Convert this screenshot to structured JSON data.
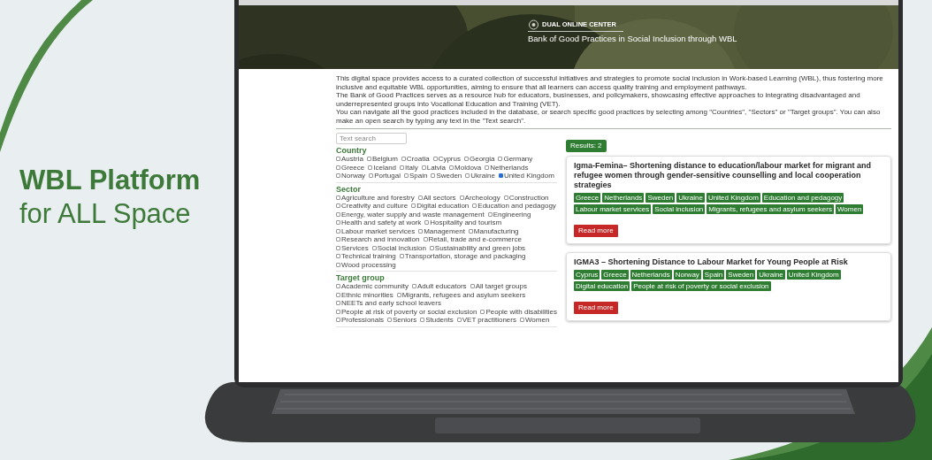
{
  "slide_title": {
    "line_1": "WBL Platform",
    "line_2": "for ALL Space"
  },
  "site": {
    "brand": "DUAL ONLINE CENTER",
    "subtitle": "Bank of Good Practices in Social Inclusion through WBL"
  },
  "intro": [
    "This digital space provides access to a curated collection of successful initiatives and strategies to promote social inclusion in Work-based Learning (WBL), thus fostering more inclusive and equitable WBL opportunities, aiming to ensure that all learners can access quality training and employment pathways.",
    "The Bank of Good Practices serves as a resource hub for educators, businesses, and policymakers, showcasing effective approaches to integrating disadvantaged and underrepresented groups into Vocational Education and Training (VET).",
    "You can navigate all the good practices included in the database, or search specific good practices by selecting among \"Countries\", \"Sectors\" or \"Target groups\". You can also make an open search by typing any text in the \"Text search\"."
  ],
  "search": {
    "placeholder": "Text search"
  },
  "filters": [
    {
      "title": "Country",
      "options": [
        {
          "label": "Austria",
          "checked": false
        },
        {
          "label": "Belgium",
          "checked": false
        },
        {
          "label": "Croatia",
          "checked": false
        },
        {
          "label": "Cyprus",
          "checked": false
        },
        {
          "label": "Georgia",
          "checked": false
        },
        {
          "label": "Germany",
          "checked": false
        },
        {
          "label": "Greece",
          "checked": false
        },
        {
          "label": "Iceland",
          "checked": false
        },
        {
          "label": "Italy",
          "checked": false
        },
        {
          "label": "Latvia",
          "checked": false
        },
        {
          "label": "Moldova",
          "checked": false
        },
        {
          "label": "Netherlands",
          "checked": false
        },
        {
          "label": "Norway",
          "checked": false
        },
        {
          "label": "Portugal",
          "checked": false
        },
        {
          "label": "Spain",
          "checked": false
        },
        {
          "label": "Sweden",
          "checked": false
        },
        {
          "label": "Ukraine",
          "checked": false
        },
        {
          "label": "United Kingdom",
          "checked": true
        }
      ]
    },
    {
      "title": "Sector",
      "options": [
        {
          "label": "Agriculture and forestry",
          "checked": false
        },
        {
          "label": "All sectors",
          "checked": false
        },
        {
          "label": "Archeology",
          "checked": false
        },
        {
          "label": "Construction",
          "checked": false
        },
        {
          "label": "Creativity and culture",
          "checked": false
        },
        {
          "label": "Digital education",
          "checked": false
        },
        {
          "label": "Education and pedagogy",
          "checked": false
        },
        {
          "label": "Energy, water supply and waste management",
          "checked": false
        },
        {
          "label": "Engineering",
          "checked": false
        },
        {
          "label": "Health and safety at work",
          "checked": false
        },
        {
          "label": "Hospitality and tourism",
          "checked": false
        },
        {
          "label": "Labour market services",
          "checked": false
        },
        {
          "label": "Management",
          "checked": false
        },
        {
          "label": "Manufacturing",
          "checked": false
        },
        {
          "label": "Research and innovation",
          "checked": false
        },
        {
          "label": "Retail, trade and e-commerce",
          "checked": false
        },
        {
          "label": "Services",
          "checked": false
        },
        {
          "label": "Social inclusion",
          "checked": false
        },
        {
          "label": "Sustainability and green jobs",
          "checked": false
        },
        {
          "label": "Technical training",
          "checked": false
        },
        {
          "label": "Transportation, storage and packaging",
          "checked": false
        },
        {
          "label": "Wood processing",
          "checked": false
        }
      ]
    },
    {
      "title": "Target group",
      "options": [
        {
          "label": "Academic community",
          "checked": false
        },
        {
          "label": "Adult educators",
          "checked": false
        },
        {
          "label": "All target groups",
          "checked": false
        },
        {
          "label": "Ethnic minorities",
          "checked": false
        },
        {
          "label": "Migrants, refugees and asylum seekers",
          "checked": false
        },
        {
          "label": "NEETs and early school leavers",
          "checked": false
        },
        {
          "label": "People at risk of poverty or social exclusion",
          "checked": false
        },
        {
          "label": "People with disabilities",
          "checked": false
        },
        {
          "label": "Professionals",
          "checked": false
        },
        {
          "label": "Seniors",
          "checked": false
        },
        {
          "label": "Students",
          "checked": false
        },
        {
          "label": "VET practitioners",
          "checked": false
        },
        {
          "label": "Women",
          "checked": false
        }
      ]
    }
  ],
  "results": {
    "count": "Results: 2",
    "items": [
      {
        "title": "Igma-Femina– Shortening distance to education/labour market for migrant and refugee women through gender-sensitive counselling and local cooperation strategies",
        "tags": [
          "Greece",
          "Netherlands",
          "Sweden",
          "Ukraine",
          "United Kingdom",
          "Education and pedagogy",
          "Labour market services",
          "Social inclusion",
          "Migrants, refugees and asylum seekers",
          "Women"
        ],
        "button": "Read more"
      },
      {
        "title": "IGMA3 – Shortening Distance to Labour Market for Young People at Risk",
        "tags": [
          "Cyprus",
          "Greece",
          "Netherlands",
          "Norway",
          "Spain",
          "Sweden",
          "Ukraine",
          "United Kingdom",
          "Digital education",
          "People at risk of poverty or social exclusion"
        ],
        "button": "Read more"
      }
    ]
  }
}
